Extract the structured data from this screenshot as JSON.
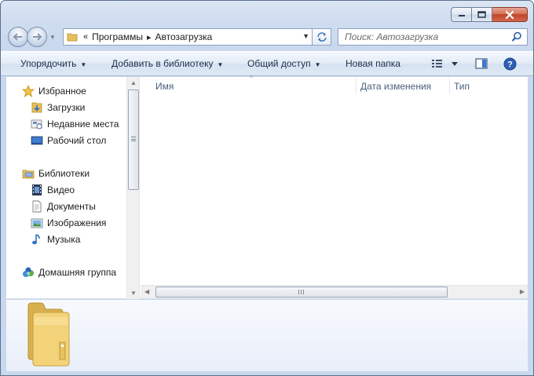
{
  "window": {
    "caption_buttons": {
      "minimize_icon": "minimize-icon",
      "maximize_icon": "maximize-icon",
      "close_icon": "close-icon"
    }
  },
  "address_bar": {
    "overflow": "«",
    "crumbs": [
      "Программы",
      "Автозагрузка"
    ],
    "separator": "▸"
  },
  "search": {
    "placeholder": "Поиск: Автозагрузка"
  },
  "toolbar": {
    "organize": "Упорядочить",
    "add_to_library": "Добавить в библиотеку",
    "share": "Общий доступ",
    "new_folder": "Новая папка"
  },
  "nav_pane": {
    "favorites": {
      "label": "Избранное",
      "items": [
        "Загрузки",
        "Недавние места",
        "Рабочий стол"
      ]
    },
    "libraries": {
      "label": "Библиотеки",
      "items": [
        "Видео",
        "Документы",
        "Изображения",
        "Музыка"
      ]
    },
    "homegroup": {
      "label": "Домашняя группа"
    }
  },
  "columns": [
    "Имя",
    "Дата изменения",
    "Тип"
  ],
  "colors": {
    "accent": "#cfdcef",
    "toolbar_text": "#1e2e45",
    "column_text": "#4c607a",
    "close_red": "#c0442a"
  }
}
